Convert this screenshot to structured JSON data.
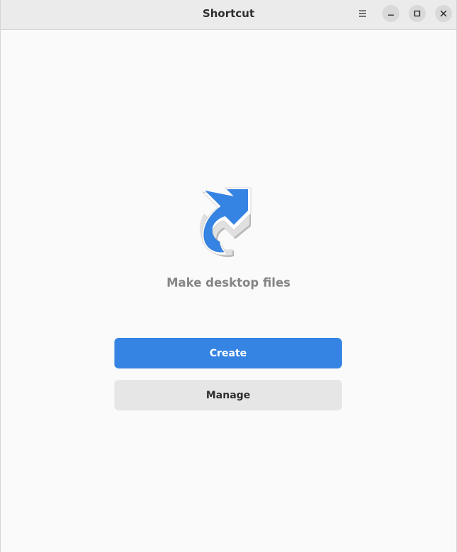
{
  "window": {
    "title": "Shortcut"
  },
  "headerbar": {
    "menu_icon": "hamburger-menu-icon",
    "minimize_icon": "minimize-icon",
    "maximize_icon": "maximize-icon",
    "close_icon": "close-icon"
  },
  "main": {
    "app_icon": "shortcut-arrow-icon",
    "subtitle": "Make desktop files",
    "create_label": "Create",
    "manage_label": "Manage"
  },
  "colors": {
    "accent": "#3584e4",
    "headerbar_bg": "#ebebeb",
    "window_bg": "#fafafa",
    "secondary_button_bg": "#e6e6e6",
    "subtitle_text": "#858585"
  }
}
